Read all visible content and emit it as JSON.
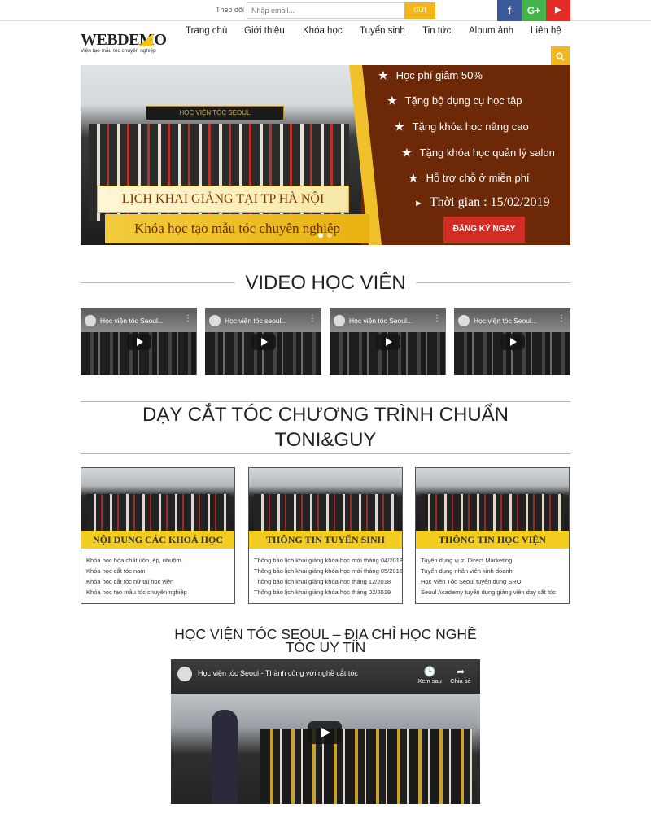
{
  "topbar": {
    "follow_label": "Theo dõi",
    "email_placeholder": "Nhập email...",
    "send_label": "GỬI",
    "social": [
      {
        "name": "facebook",
        "glyph": "f",
        "color": "#3b5998"
      },
      {
        "name": "google-plus",
        "glyph": "G+",
        "color": "#44b44a"
      },
      {
        "name": "youtube",
        "glyph": "▶",
        "color": "#e52d27"
      }
    ]
  },
  "header": {
    "logo_text": "WEBDEMO",
    "logo_tagline": "Viện tạo mẫu tóc chuyên nghiệp",
    "nav": [
      "Trang chủ",
      "Giới thiệu",
      "Khóa học",
      "Tuyển sinh",
      "Tin tức",
      "Album ảnh",
      "Liên hệ"
    ],
    "search_icon": "search-icon"
  },
  "banner": {
    "sign_text": "HỌC VIỆN TÓC SEOUL",
    "caption_line1": "LỊCH KHAI GIẢNG TẠI TP HÀ NỘI",
    "caption_line2": "Khóa học tạo mẫu tóc chuyên nghiệp",
    "promos": [
      "Học phí giảm 50%",
      "Tặng bộ dụng cụ học tập",
      "Tặng khóa học nâng cao",
      "Tặng khóa học quản lý salon",
      "Hỗ trợ chỗ ở miễn phí"
    ],
    "time_label": "Thời gian : 15/02/2019",
    "register_label": "ĐĂNG KÝ NGAY",
    "slides": 2,
    "active_slide": 1
  },
  "video_section": {
    "title": "VIDEO HỌC VIÊN",
    "videos": [
      {
        "title": "Học viện tóc Seoul..."
      },
      {
        "title": "Học viện tóc seoul..."
      },
      {
        "title": "Học viện tóc Seoul..."
      },
      {
        "title": "Học viện tóc Seoul..."
      }
    ]
  },
  "program_section": {
    "title_line1": "DẠY CẮT TÓC CHƯƠNG TRÌNH CHUẨN",
    "title_line2": "TONI&GUY",
    "cards": [
      {
        "title": "NỘI DUNG CÁC KHOÁ HỌC",
        "items": [
          "Khóa học hóa chất uốn, ép, nhuộm.",
          "Khóa học cắt tóc nam",
          "Khóa học cắt tóc nữ tại học viện",
          "Khóa học tạo mẫu tóc chuyên nghiệp"
        ]
      },
      {
        "title": "THÔNG TIN TUYỂN SINH",
        "items": [
          "Thông báo lịch khai giảng khóa học mới tháng 04/2018",
          "Thông báo lịch khai giảng khóa học mới tháng 05/2018",
          "Thông báo lịch khai giảng khóa học tháng 12/2018",
          "Thông báo lịch khai giảng khóa học tháng 02/2019"
        ]
      },
      {
        "title": "THÔNG TIN HỌC VIỆN",
        "items": [
          "Tuyển dụng vị trí Direct Marketing",
          "Tuyển dụng nhân viên kinh doanh",
          "Học Viện Tóc Seoul tuyển dụng SRO",
          "Seoul Academy tuyển dụng giảng viên dạy cắt tóc"
        ]
      }
    ]
  },
  "feature_section": {
    "title_line1": "HỌC VIỆN TÓC SEOUL – ĐỊA CHỈ HỌC NGHỀ",
    "title_line2": "TÓC UY TÍN",
    "video_title": "Học viện tóc Seoul - Thành công với nghề cắt tóc",
    "watch_later": "Xem sau",
    "share": "Chia sẻ"
  },
  "colors": {
    "accent": "#f3b71a",
    "banner_bg": "#6c2807",
    "register": "#d22d24"
  }
}
